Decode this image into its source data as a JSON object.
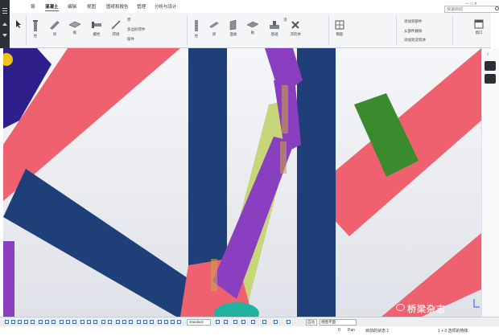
{
  "menu": {
    "tabs": [
      "文件",
      "钢",
      "混凝土",
      "编辑",
      "视图",
      "图纸和报告",
      "管理",
      "分析与设计"
    ],
    "active_tab": "混凝土",
    "search_placeholder": "快速启动"
  },
  "ribbon": {
    "groups": [
      {
        "label": "柱",
        "icon": "column-icon"
      },
      {
        "label": "梁",
        "icon": "beam-icon"
      },
      {
        "label": "板",
        "icon": "slab-icon"
      },
      {
        "label": "螺栓",
        "icon": "bolt-icon"
      },
      {
        "label": "焊接",
        "icon": "weld-icon"
      },
      {
        "label": "柱",
        "icon": "column-icon"
      },
      {
        "label": "梁",
        "icon": "beam-icon"
      },
      {
        "label": "面板",
        "icon": "panel-icon"
      },
      {
        "label": "板",
        "icon": "slab-icon"
      },
      {
        "label": "基础",
        "icon": "footing-icon"
      },
      {
        "label": "浇筑体",
        "icon": "pour-icon"
      },
      {
        "label": "钢筋",
        "icon": "rebar-icon"
      }
    ],
    "small_items": {
      "weld_item": "焊",
      "polygon_weld": "多边形焊件",
      "parts": "部件",
      "pour_obj": "浇",
      "add_to_assembly": "添加到部件",
      "remove_from_assembly": "从部件删除",
      "cast_unit": "添加到浇筑体"
    },
    "right_label": "窗口"
  },
  "bottom_bar": {
    "standard_value": "standard",
    "select_a": "自动",
    "select_b": "视图平面"
  },
  "status_bar": {
    "coord": "0",
    "mode": "Pan",
    "state": "目前的状态 1",
    "selection": "1 + 0 选项的物体"
  },
  "watermark": "桥梁杂志",
  "colors": {
    "tube_red": "#f0616f",
    "tube_blue": "#1f3f78",
    "purple": "#8a3fc1",
    "green_band": "#3a8a2e",
    "olive": "#c8d67a",
    "navy_plate": "#2e1f8a",
    "teal": "#22b3a0",
    "yellow": "#f2c21a"
  }
}
